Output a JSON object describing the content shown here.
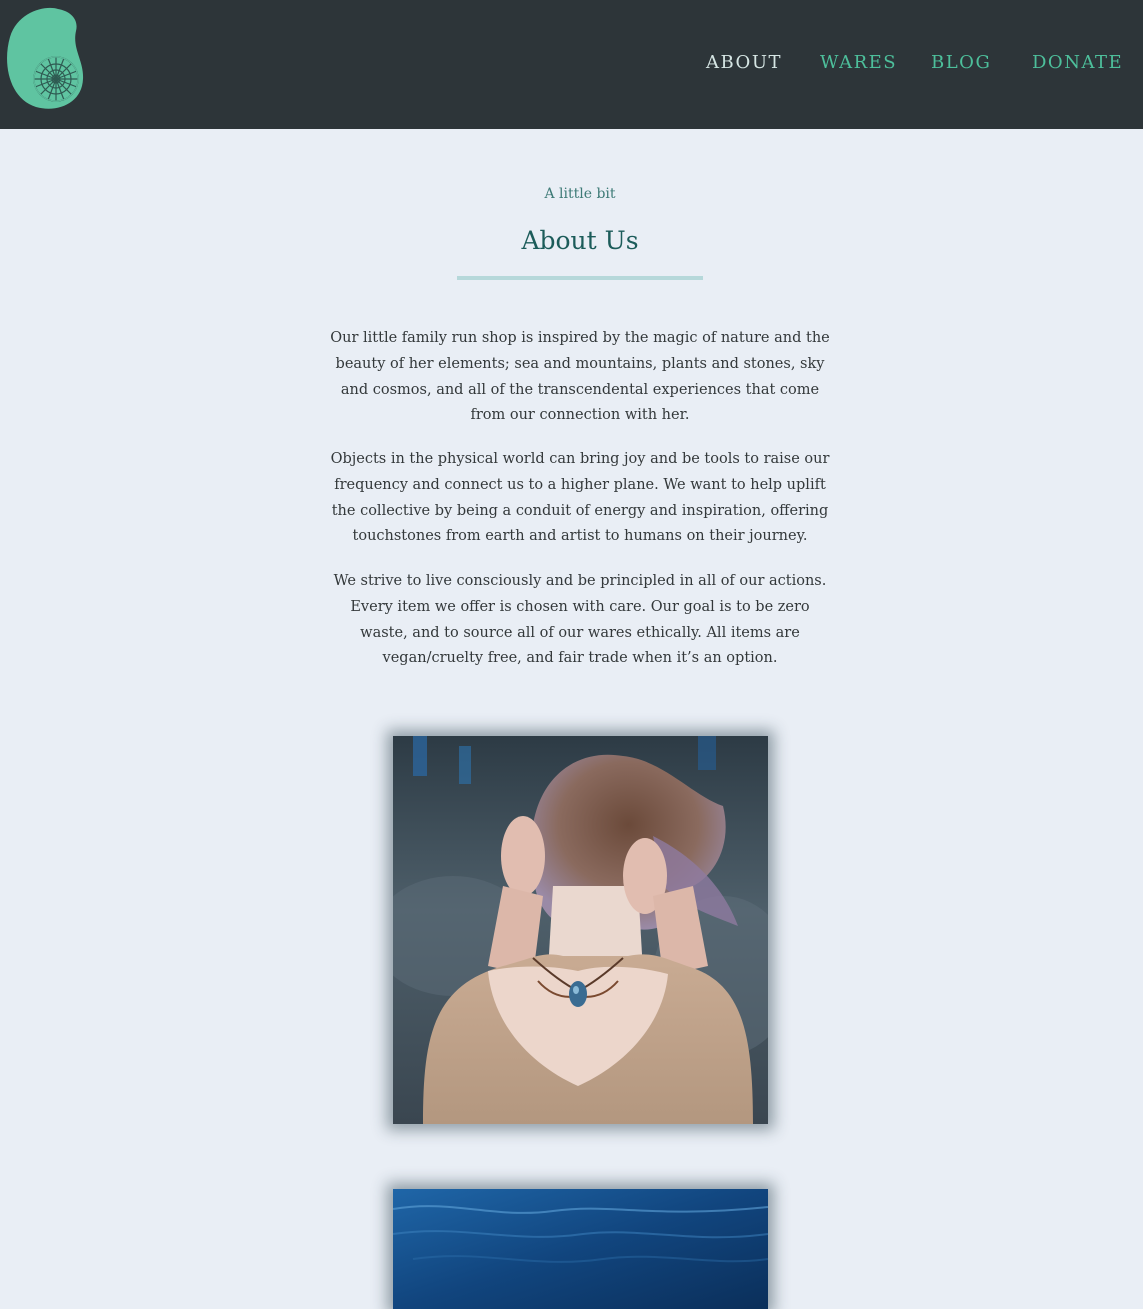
{
  "header": {
    "logo_icon": "nautilus-shell-icon",
    "nav": [
      {
        "label": "ABOUT",
        "color": "#d6e6e4"
      },
      {
        "label": "WARES",
        "color": "#4dbf9b"
      },
      {
        "label": "BLOG",
        "color": "#4dbf9b"
      },
      {
        "label": "DONATE",
        "color": "#4dbf9b"
      }
    ]
  },
  "about": {
    "eyebrow": "A little bit",
    "title": "About Us",
    "paragraphs": [
      "Our little family run shop is inspired by the magic of nature and the beauty of her elements; sea and mountains, plants and stones, sky and cosmos, and all of the transcendental experiences that come from our connection with her.",
      "Objects in the physical world can bring joy and be tools to raise our frequency and connect us to a higher plane. We want to help uplift the collective by being a conduit of energy and inspiration, offering touchstones from earth and artist to humans on their journey.",
      "We strive to live consciously and be principled in all of our actions. Every item we offer is chosen with care. Our goal is to be zero waste, and to source all of our wares ethically. All items are vegan/cruelty free, and fair trade when it’s an option."
    ]
  },
  "colors": {
    "header_bg": "#2d3539",
    "page_bg": "#e9eef5",
    "accent": "#4dbf9b",
    "title": "#1c5c5a"
  }
}
